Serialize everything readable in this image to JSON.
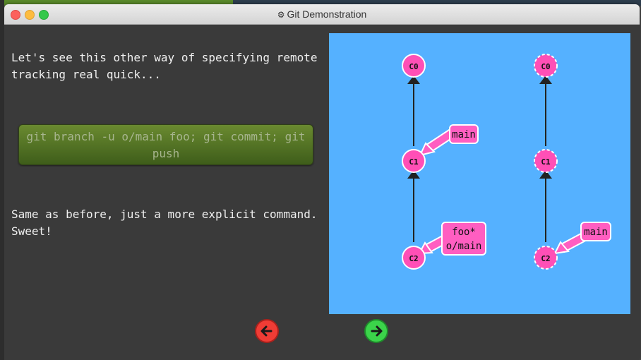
{
  "window": {
    "title": "Git Demonstration"
  },
  "lesson": {
    "intro": "Let's see this other way of specifying remote tracking real quick...",
    "command": "git branch -u o/main foo; git commit; git push",
    "outro": "Same as before, just a more explicit command. Sweet!"
  },
  "graph": {
    "local": {
      "commits": [
        "C0",
        "C1",
        "C2"
      ],
      "branches": [
        {
          "label": "main",
          "target": "C1"
        },
        {
          "label": "foo*\no/main",
          "target": "C2"
        }
      ]
    },
    "remote": {
      "commits": [
        "C0",
        "C1",
        "C2"
      ],
      "branches": [
        {
          "label": "main",
          "target": "C2"
        }
      ]
    }
  },
  "colors": {
    "viz_background": "#55b1ff",
    "commit_fill": "#ff4fb6",
    "branch_fill": "#ff5ec1",
    "command_box": "#5b7a26"
  },
  "icons": {
    "settings": "gear-icon",
    "prev": "arrow-left-icon",
    "next": "arrow-right-icon"
  }
}
